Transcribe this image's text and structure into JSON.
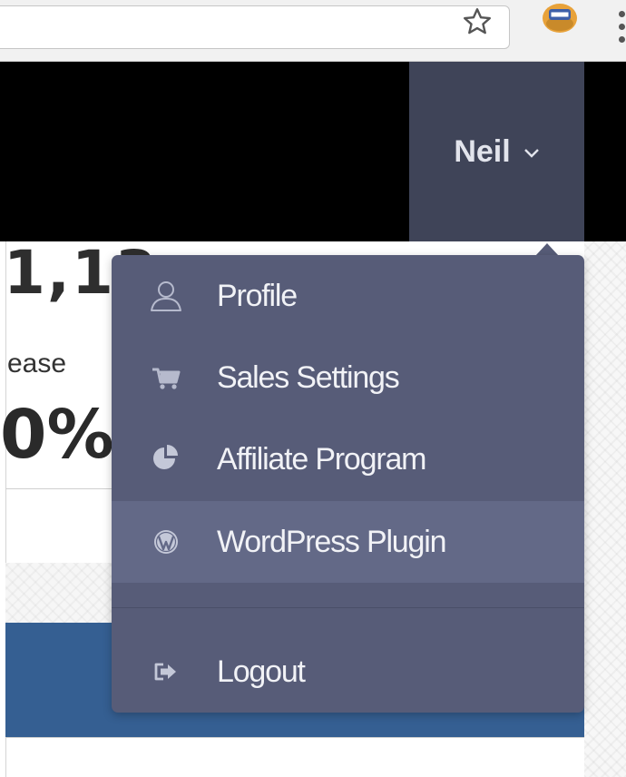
{
  "header": {
    "user_name": "Neil"
  },
  "background": {
    "stat_number": "1,13",
    "stat_label": "ease",
    "stat_percent": "0%"
  },
  "user_menu": {
    "items": [
      {
        "label": "Profile",
        "icon": "user-icon"
      },
      {
        "label": "Sales Settings",
        "icon": "cart-icon"
      },
      {
        "label": "Affiliate Program",
        "icon": "pie-chart-icon"
      },
      {
        "label": "WordPress Plugin",
        "icon": "wordpress-icon",
        "highlighted": true
      },
      {
        "label": "Logout",
        "icon": "logout-icon"
      }
    ]
  },
  "colors": {
    "menu_bg": "#575c78",
    "menu_highlight": "#636987",
    "toggle_bg": "#3f4458",
    "header_bg": "#000000",
    "accent_band": "#355f92"
  }
}
